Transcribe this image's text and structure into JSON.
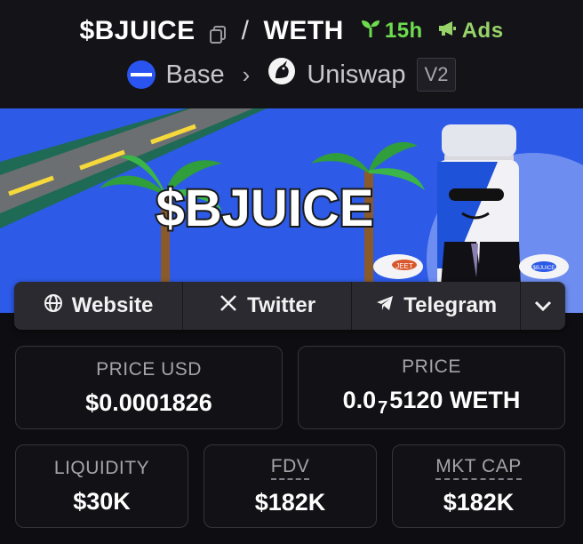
{
  "header": {
    "base_token": "$BJUICE",
    "separator": "/",
    "quote_token": "WETH",
    "age": "15h",
    "ads_label": "Ads",
    "chain": "Base",
    "dex": "Uniswap",
    "dex_version": "V2"
  },
  "banner": {
    "title_text": "$BJUICE",
    "left_tag": "JEET",
    "right_tag": "$BJUICE"
  },
  "links": {
    "website": "Website",
    "twitter": "Twitter",
    "telegram": "Telegram"
  },
  "stats": {
    "price_usd_label": "PRICE USD",
    "price_usd_value": "$0.0001826",
    "price_label": "PRICE",
    "price_value_prefix": "0.0",
    "price_value_zeros": "7",
    "price_value_suffix": "5120 WETH",
    "liquidity_label": "LIQUIDITY",
    "liquidity_value": "$30K",
    "fdv_label": "FDV",
    "fdv_value": "$182K",
    "mktcap_label": "MKT CAP",
    "mktcap_value": "$182K"
  },
  "colors": {
    "accent_green": "#6fdc4f",
    "ads_green": "#98d36a",
    "chain_blue": "#2a54f0",
    "banner_blue": "#2d5ae6"
  }
}
